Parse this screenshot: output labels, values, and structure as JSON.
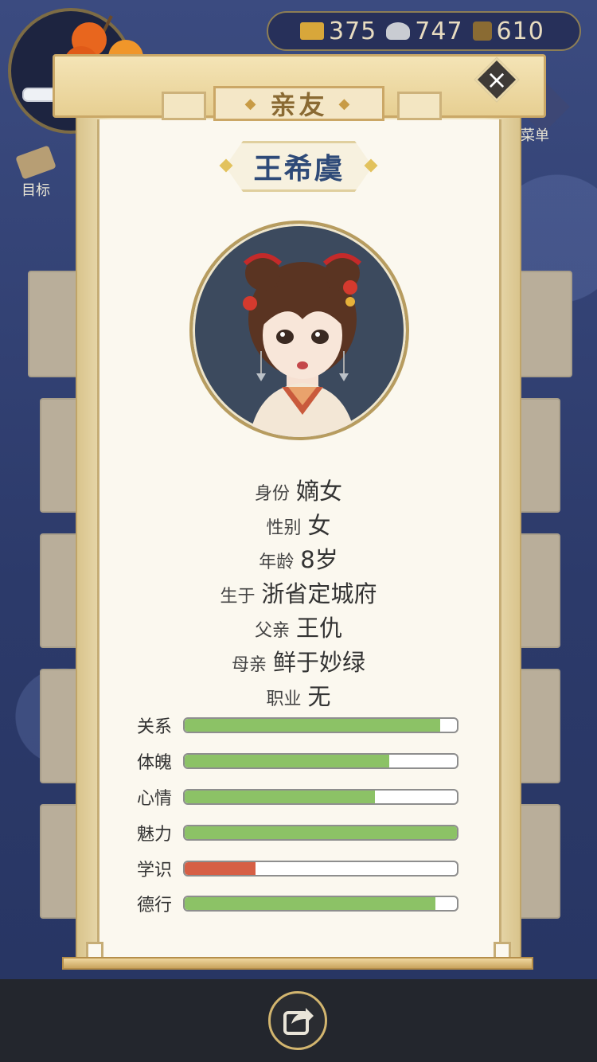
{
  "hud": {
    "currency": [
      {
        "icon": "gold-ingot-icon",
        "value": "375",
        "color": "#d8a73a"
      },
      {
        "icon": "silver-ingot-icon",
        "value": "747",
        "color": "#c9ccd2"
      },
      {
        "icon": "copper-coin-icon",
        "value": "610",
        "color": "#8a6b33"
      }
    ],
    "goal_label": "目标",
    "menu_label": "菜单"
  },
  "dialog": {
    "title": "亲友",
    "close_icon": "close-icon",
    "character": {
      "name": "王希虞",
      "info": [
        {
          "label": "身份",
          "value": "嫡女"
        },
        {
          "label": "性别",
          "value": "女"
        },
        {
          "label": "年龄",
          "value": "8岁"
        },
        {
          "label": "生于",
          "value": "浙省定城府"
        },
        {
          "label": "父亲",
          "value": "王仇"
        },
        {
          "label": "母亲",
          "value": "鲜于妙绿"
        },
        {
          "label": "职业",
          "value": "无"
        }
      ],
      "stats": [
        {
          "label": "关系",
          "level": 0.94,
          "color": "#8cc266"
        },
        {
          "label": "体魄",
          "level": 0.75,
          "color": "#8cc266"
        },
        {
          "label": "心情",
          "level": 0.7,
          "color": "#8cc266"
        },
        {
          "label": "魅力",
          "level": 1.0,
          "color": "#8cc266"
        },
        {
          "label": "学识",
          "level": 0.26,
          "color": "#d65f45"
        },
        {
          "label": "德行",
          "level": 0.92,
          "color": "#8cc266"
        }
      ]
    }
  },
  "footer": {
    "share_icon": "share-icon"
  }
}
